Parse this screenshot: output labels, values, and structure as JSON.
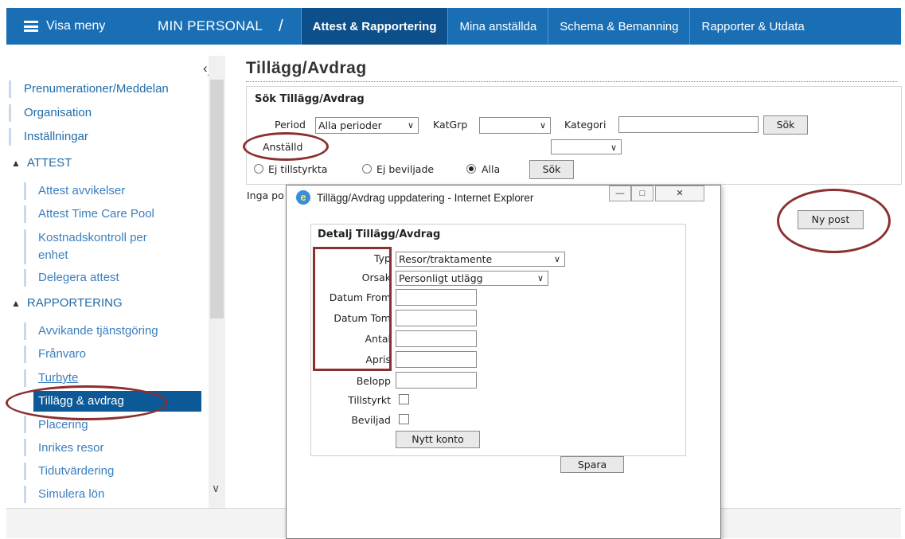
{
  "nav": {
    "menu_label": "Visa meny",
    "brand": "MIN PERSONAL",
    "separator": "/",
    "tabs": [
      {
        "label": "Attest & Rapportering",
        "active": true
      },
      {
        "label": "Mina anställda",
        "active": false
      },
      {
        "label": "Schema & Bemanning",
        "active": false
      },
      {
        "label": "Rapporter & Utdata",
        "active": false
      }
    ]
  },
  "sidebar": {
    "top_items": [
      "Prenumerationer/Meddelan",
      "Organisation",
      "Inställningar"
    ],
    "attest_header": "ATTEST",
    "attest_items": [
      "Attest avvikelser",
      "Attest Time Care Pool",
      "Kostnadskontroll per",
      "enhet",
      "Delegera attest"
    ],
    "rapport_header": "RAPPORTERING",
    "rapport_items": [
      "Avvikande tjänstgöring",
      "Frånvaro",
      "Turbyte",
      "Tillägg & avdrag",
      "Placering",
      "Inrikes resor",
      "Tidutvärdering",
      "Simulera lön"
    ],
    "active_item": "Tillägg & avdrag"
  },
  "main": {
    "title": "Tillägg/Avdrag",
    "search_title": "Sök Tillägg/Avdrag",
    "period_label": "Period",
    "period_value": "Alla perioder",
    "katgrp_label": "KatGrp",
    "katgrp_value": "",
    "kategori_label": "Kategori",
    "kategori_value": "",
    "sok_label": "Sök",
    "anstalld_label": "Anställd",
    "radios": [
      {
        "label": "Ej tillstyrkta",
        "checked": false
      },
      {
        "label": "Ej beviljade",
        "checked": false
      },
      {
        "label": "Alla",
        "checked": true
      }
    ],
    "sok2_label": "Sök",
    "no_posts_text": "Inga po",
    "ny_post_label": "Ny post"
  },
  "popup": {
    "window_title": "Tillägg/Avdrag uppdatering - Internet Explorer",
    "section_title": "Detalj Tillägg/Avdrag",
    "typ_label": "Typ",
    "typ_value": "Resor/traktamente",
    "orsak_label": "Orsak",
    "orsak_value": "Personligt utlägg",
    "datum_from_label": "Datum From",
    "datum_tom_label": "Datum Tom",
    "antal_label": "Antal",
    "apris_label": "Apris",
    "belopp_label": "Belopp",
    "tillstyrkt_label": "Tillstyrkt",
    "beviljad_label": "Beviljad",
    "nytt_konto_label": "Nytt konto",
    "spara_label": "Spara"
  },
  "colors": {
    "nav_bg": "#1a6fb4",
    "nav_active_bg": "#0c4f8a",
    "link": "#1f6ba8",
    "highlight": "#8b3030"
  }
}
